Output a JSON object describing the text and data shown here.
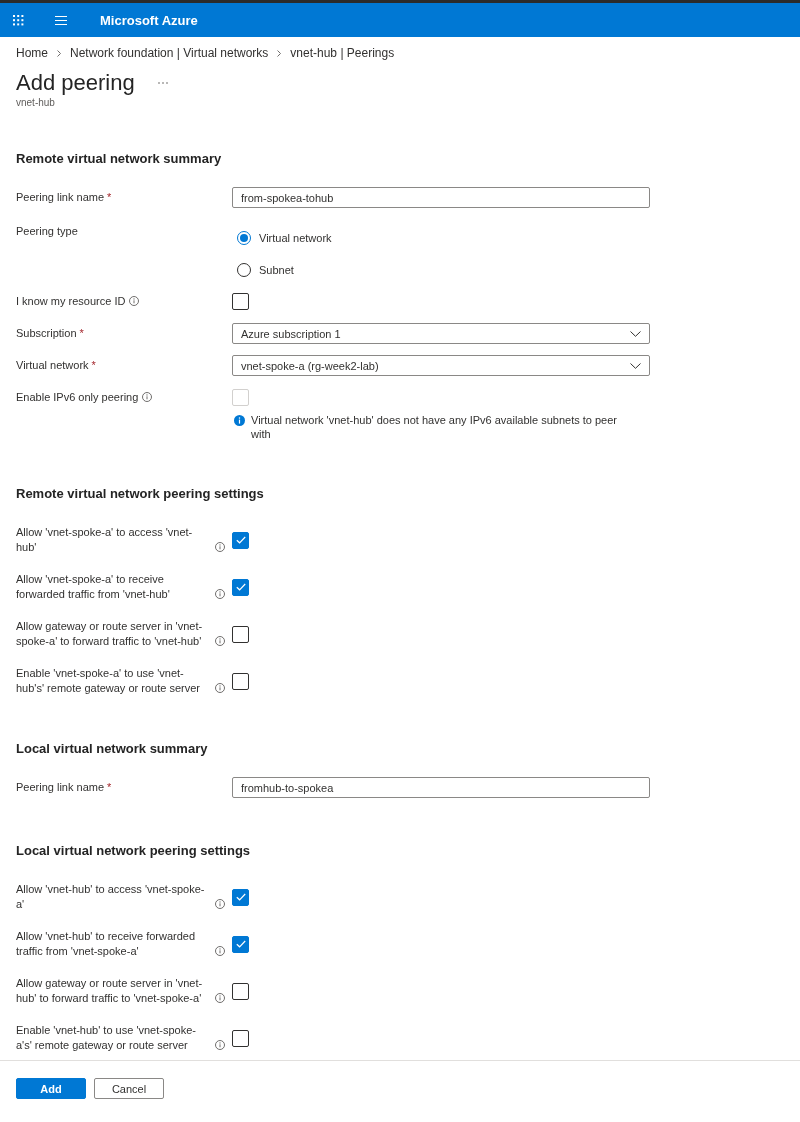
{
  "header": {
    "title": "Microsoft Azure"
  },
  "breadcrumb": [
    {
      "label": "Home"
    },
    {
      "label": "Network foundation | Virtual networks"
    },
    {
      "label": "vnet-hub | Peerings"
    }
  ],
  "page": {
    "title": "Add peering",
    "subtitle": "vnet-hub"
  },
  "sections": [
    {
      "kind": "summary",
      "title": "Remote virtual network summary",
      "fields": [
        {
          "kind": "text",
          "label": "Peering link name",
          "required_mark": "*",
          "info": false,
          "value": "from-spokea-tohub"
        },
        {
          "kind": "radio",
          "label": "Peering type",
          "info": false,
          "options": [
            {
              "label": "Virtual network",
              "selected": true
            },
            {
              "label": "Subnet",
              "selected": false
            }
          ]
        },
        {
          "kind": "checkbox",
          "label": "I know my resource ID",
          "info": true,
          "checked": false,
          "disabled": false
        },
        {
          "kind": "select",
          "label": "Subscription",
          "required_mark": "*",
          "info": false,
          "value": "Azure subscription 1"
        },
        {
          "kind": "select",
          "label": "Virtual network",
          "required_mark": "*",
          "info": false,
          "value": "vnet-spoke-a (rg-week2-lab)"
        },
        {
          "kind": "checkbox",
          "label": "Enable IPv6 only peering",
          "info": true,
          "checked": false,
          "disabled": true,
          "message": "Virtual network 'vnet-hub' does not have any IPv6 available subnets to peer with"
        }
      ]
    },
    {
      "kind": "settings",
      "title": "Remote virtual network peering settings",
      "fields": [
        {
          "kind": "checkbox",
          "label": "Allow 'vnet-spoke-a' to access 'vnet-hub'",
          "info": true,
          "checked": true,
          "disabled": false
        },
        {
          "kind": "checkbox",
          "label": "Allow 'vnet-spoke-a' to receive forwarded traffic from 'vnet-hub'",
          "info": true,
          "checked": true,
          "disabled": false
        },
        {
          "kind": "checkbox",
          "label": "Allow gateway or route server in 'vnet-spoke-a' to forward traffic to 'vnet-hub'",
          "info": true,
          "checked": false,
          "disabled": false
        },
        {
          "kind": "checkbox",
          "label": "Enable 'vnet-spoke-a' to use 'vnet-hub's' remote gateway or route server",
          "info": true,
          "checked": false,
          "disabled": false
        }
      ]
    },
    {
      "kind": "summary",
      "title": "Local virtual network summary",
      "fields": [
        {
          "kind": "text",
          "label": "Peering link name",
          "required_mark": "*",
          "info": false,
          "value": "fromhub-to-spokea"
        }
      ]
    },
    {
      "kind": "settings",
      "title": "Local virtual network peering settings",
      "fields": [
        {
          "kind": "checkbox",
          "label": "Allow 'vnet-hub' to access 'vnet-spoke-a'",
          "info": true,
          "checked": true,
          "disabled": false
        },
        {
          "kind": "checkbox",
          "label": "Allow 'vnet-hub' to receive forwarded traffic from 'vnet-spoke-a'",
          "info": true,
          "checked": true,
          "disabled": false
        },
        {
          "kind": "checkbox",
          "label": "Allow gateway or route server in 'vnet-hub' to forward traffic to 'vnet-spoke-a'",
          "info": true,
          "checked": false,
          "disabled": false
        },
        {
          "kind": "checkbox",
          "label": "Enable 'vnet-hub' to use 'vnet-spoke-a's' remote gateway or route server",
          "info": true,
          "checked": false,
          "disabled": false
        }
      ]
    }
  ],
  "buttons": [
    {
      "label": "Add",
      "primary": true
    },
    {
      "label": "Cancel",
      "primary": false
    }
  ]
}
